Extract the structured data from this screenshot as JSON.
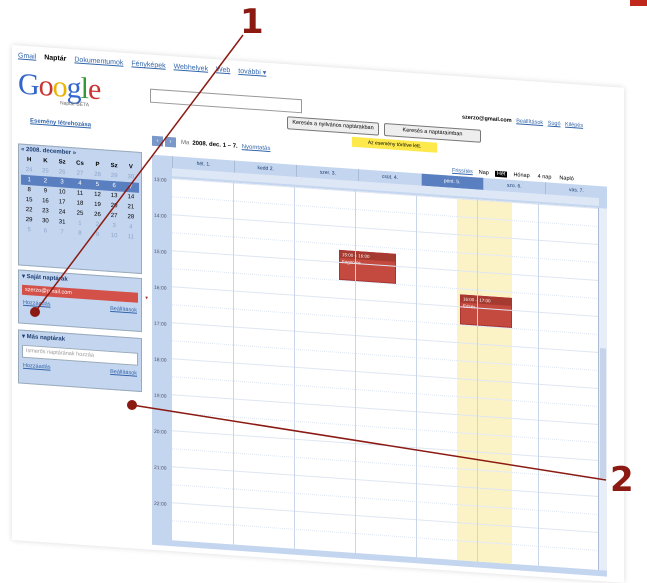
{
  "topnav": [
    "Gmail",
    "Naptár",
    "Dokumentumok",
    "Fényképek",
    "Webhelyek",
    "Web",
    "további ▾"
  ],
  "logo": {
    "text": "Google",
    "sub": "Naptár BÉTA"
  },
  "buttons": {
    "search_public": "Keresés a nyilvános naptárakban",
    "search_my": "Keresés a naptáraimban"
  },
  "user": {
    "email": "szerzo@gmail.com",
    "links": [
      "Beállítások",
      "Súgó",
      "Kilépés"
    ]
  },
  "notice": "Az esemény törölve lett.",
  "create_event": "Esemény létrehozása",
  "nav": {
    "prev": "‹",
    "next": "›",
    "today": "Ma",
    "range": "2008. dec. 1 – 7.",
    "print": "Nyomtatás"
  },
  "views": {
    "refresh": "Frissítés",
    "items": [
      "Nap",
      "Hét",
      "Hónap",
      "4 nap",
      "Napló"
    ],
    "selected": 1
  },
  "mini_calendar": {
    "title": "« 2008. december »",
    "weekdays": [
      "H",
      "K",
      "Sz",
      "Cs",
      "P",
      "Sz",
      "V"
    ],
    "rows": [
      [
        "24",
        "25",
        "26",
        "27",
        "28",
        "29",
        "30"
      ],
      [
        "1",
        "2",
        "3",
        "4",
        "5",
        "6",
        "7"
      ],
      [
        "8",
        "9",
        "10",
        "11",
        "12",
        "13",
        "14"
      ],
      [
        "15",
        "16",
        "17",
        "18",
        "19",
        "20",
        "21"
      ],
      [
        "22",
        "23",
        "24",
        "25",
        "26",
        "27",
        "28"
      ],
      [
        "29",
        "30",
        "31",
        "1",
        "2",
        "3",
        "4"
      ],
      [
        "5",
        "6",
        "7",
        "8",
        "9",
        "10",
        "11"
      ]
    ]
  },
  "my_calendars": {
    "title": "▾ Saját naptárak",
    "item": "szerzo@gmail.com",
    "add": "Hozzáadás",
    "settings": "Beállítások"
  },
  "other_calendars": {
    "title": "▾ Más naptárak",
    "placeholder": "Ismerős naptárának hozzáa",
    "add": "Hozzáadás",
    "settings": "Beállítások"
  },
  "day_headers": [
    "hét. 1.",
    "kedd 2.",
    "szer. 3.",
    "csüt. 4.",
    "pént. 5.",
    "szo. 6.",
    "vas. 7."
  ],
  "times": [
    "13:00",
    "14:00",
    "15:00",
    "16:00",
    "17:00",
    "18:00",
    "19:00",
    "20:00",
    "21:00",
    "22:00"
  ],
  "events": [
    {
      "head": "15:00 – 16:00",
      "title": "Fogorvos"
    },
    {
      "head": "16:00 – 17:00",
      "title": "Edzés"
    }
  ],
  "callouts": [
    "1",
    "2"
  ]
}
